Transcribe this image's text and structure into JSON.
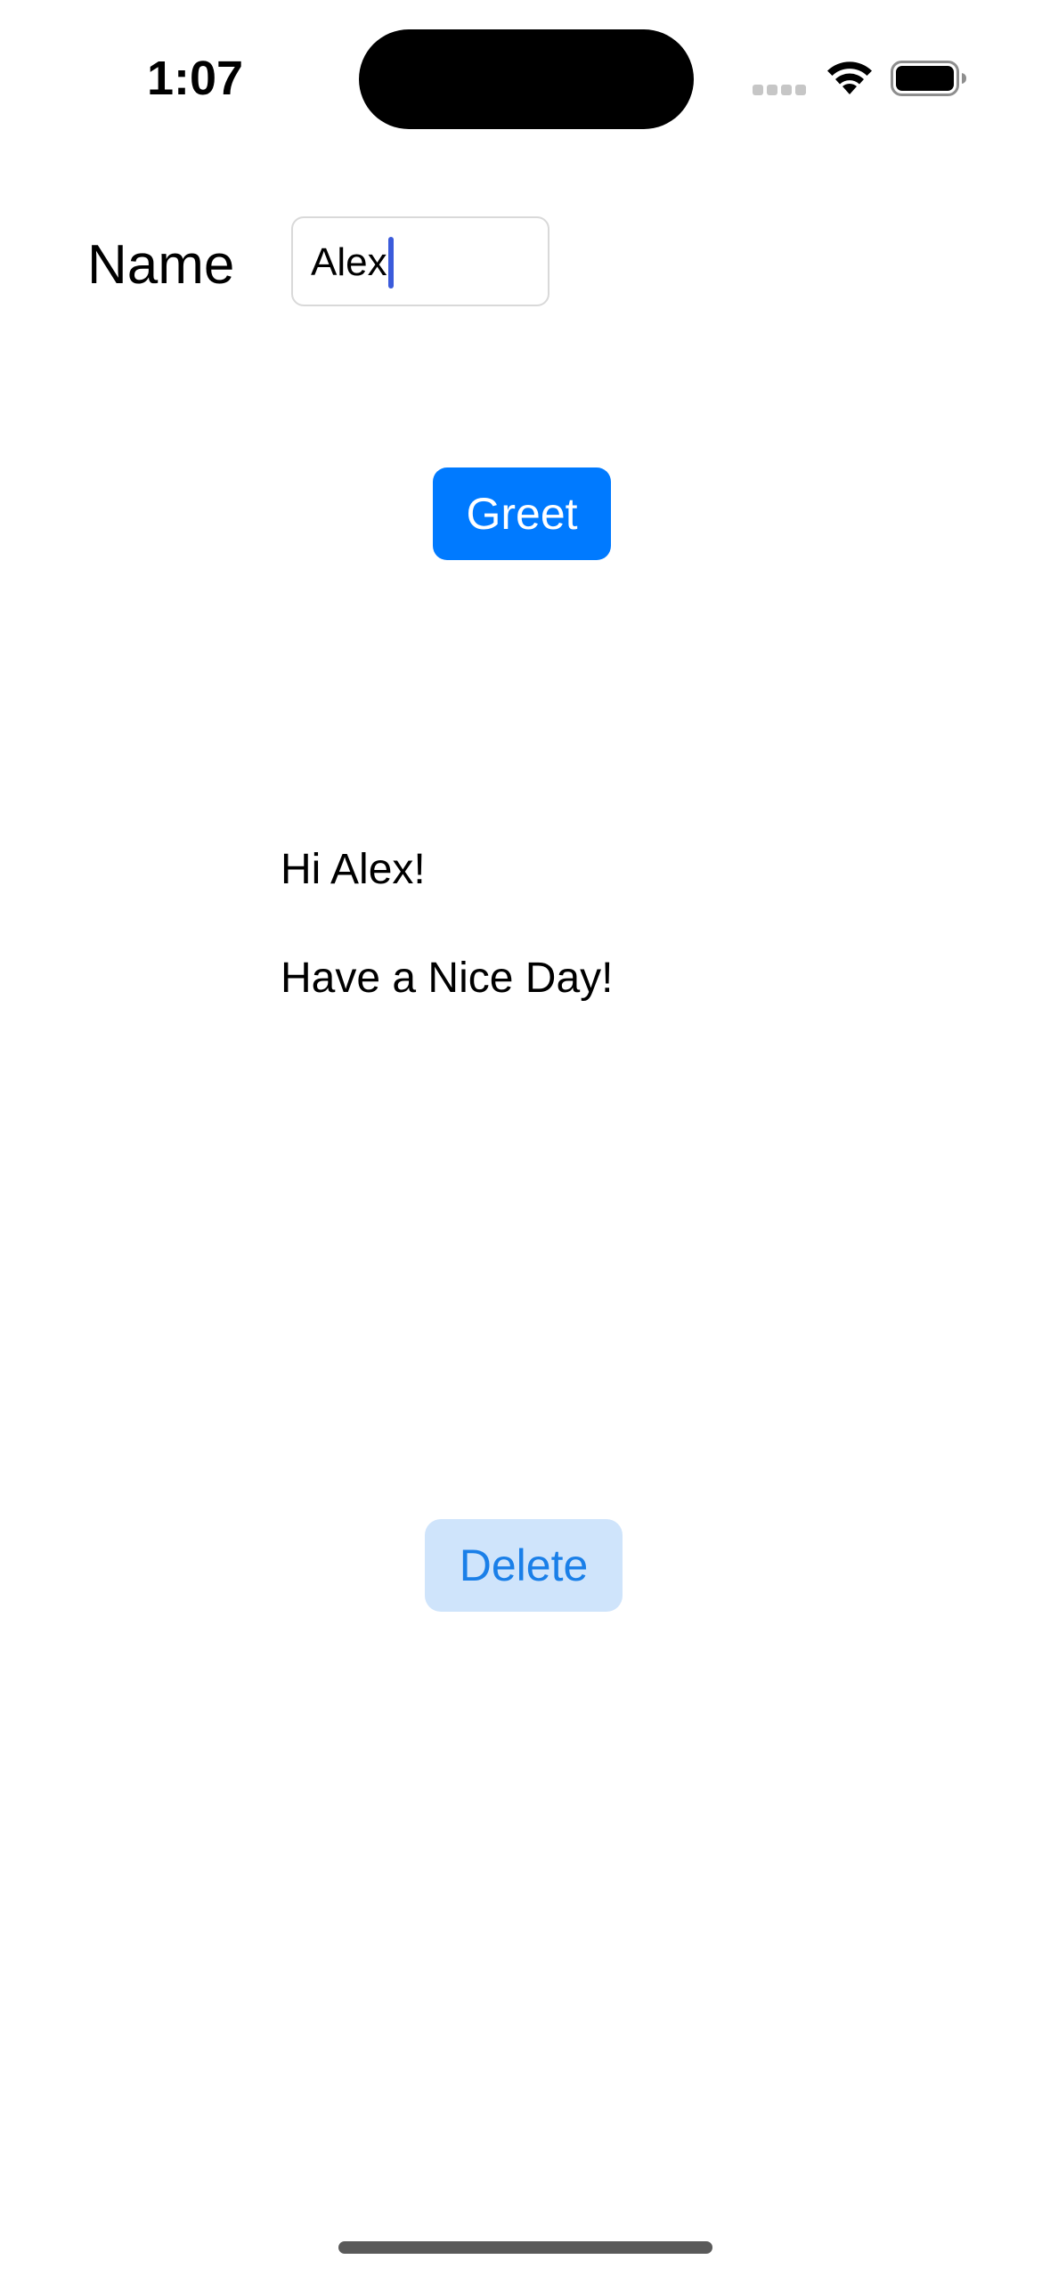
{
  "status_bar": {
    "time": "1:07",
    "signal_icon": "cellular-signal-icon",
    "wifi_icon": "wifi-icon",
    "battery_icon": "battery-icon"
  },
  "form": {
    "name_label": "Name",
    "name_value": "Alex"
  },
  "buttons": {
    "greet_label": "Greet",
    "delete_label": "Delete"
  },
  "greeting": {
    "line1": "Hi Alex!",
    "line2": "Have a Nice Day!"
  },
  "colors": {
    "accent": "#007aff",
    "delete_background": "#cfe4fb",
    "delete_text": "#1a7fe8",
    "caret": "#3b5bdb"
  }
}
